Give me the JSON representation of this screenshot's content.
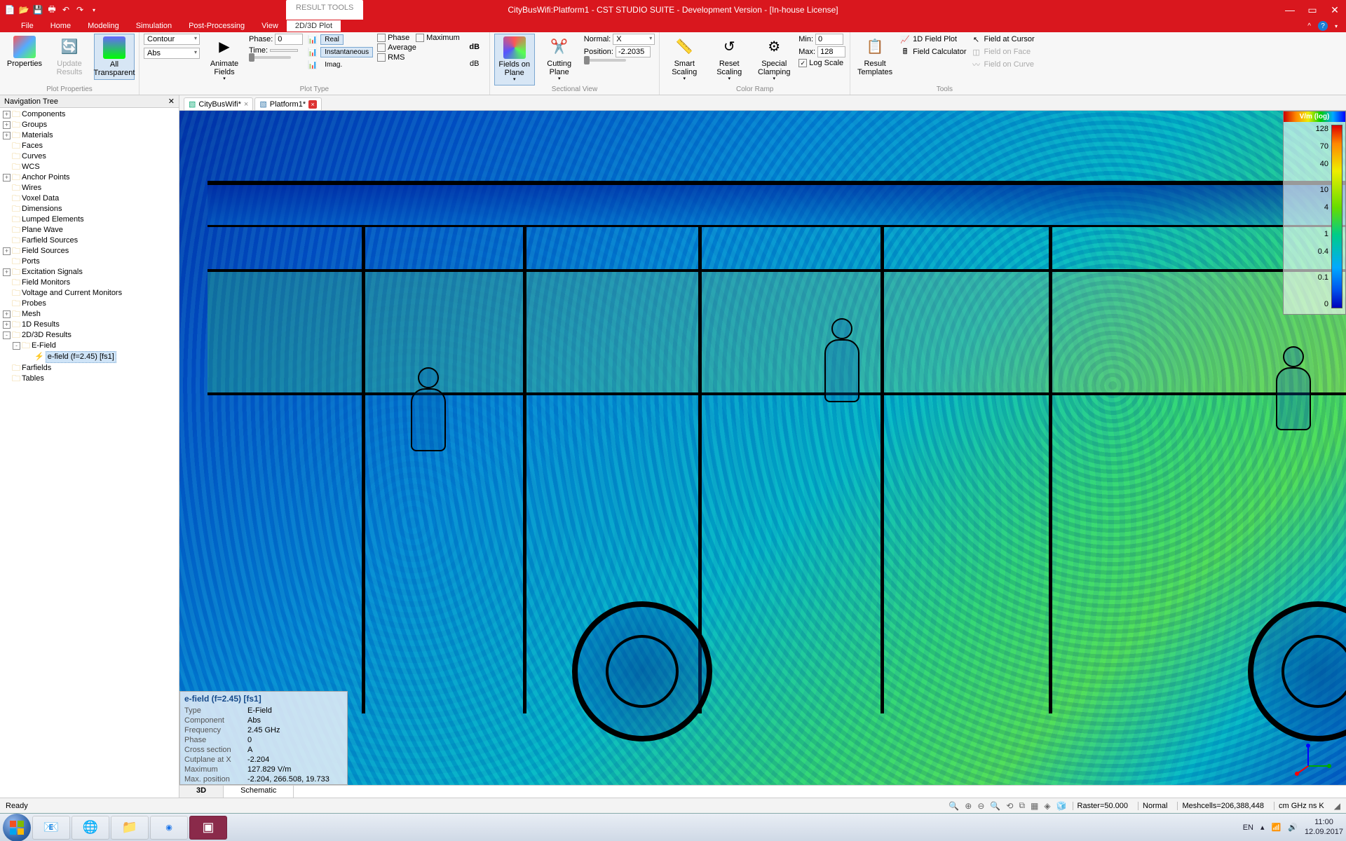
{
  "title": "CityBusWifi:Platform1 - CST STUDIO SUITE - Development Version - [In-house License]",
  "result_tools_label": "RESULT TOOLS",
  "menu": [
    "File",
    "Home",
    "Modeling",
    "Simulation",
    "Post-Processing",
    "View",
    "2D/3D Plot"
  ],
  "active_menu": "2D/3D Plot",
  "ribbon": {
    "groups": {
      "plot_properties": {
        "label": "Plot Properties",
        "properties_btn": "Properties",
        "update_results_btn": "Update\nResults",
        "all_transparent_btn": "All\nTransparent"
      },
      "plot_type": {
        "label": "Plot Type",
        "style_combo": "Contour",
        "component_combo": "Abs",
        "animate_fields_btn": "Animate\nFields",
        "phase_label": "Phase:",
        "phase_value": "0",
        "time_label": "Time:",
        "time_value": "",
        "real_btn": "Real",
        "instantaneous_btn": "Instantaneous",
        "imag_btn": "Imag.",
        "phase_chk": "Phase",
        "maximum_chk": "Maximum",
        "average_chk": "Average",
        "rms_chk": "RMS",
        "db_btn": "dB"
      },
      "sectional_view": {
        "label": "Sectional View",
        "fields_on_plane_btn": "Fields on\nPlane",
        "cutting_plane_btn": "Cutting\nPlane",
        "normal_label": "Normal:",
        "normal_value": "X",
        "position_label": "Position:",
        "position_value": "-2.2035"
      },
      "color_ramp": {
        "label": "Color Ramp",
        "smart_scaling_btn": "Smart\nScaling",
        "reset_scaling_btn": "Reset\nScaling",
        "special_clamping_btn": "Special\nClamping",
        "min_label": "Min:",
        "min_value": "0",
        "max_label": "Max:",
        "max_value": "128",
        "log_scale_chk": "Log Scale"
      },
      "tools": {
        "label": "Tools",
        "result_templates_btn": "Result\nTemplates",
        "fieldplot_1d": "1D Field Plot",
        "field_calculator": "Field Calculator",
        "field_at_cursor": "Field at Cursor",
        "field_on_face": "Field on Face",
        "field_on_curve": "Field on Curve"
      }
    }
  },
  "navtree": {
    "title": "Navigation Tree",
    "items": [
      {
        "l": 0,
        "e": "+",
        "t": "Components"
      },
      {
        "l": 0,
        "e": "+",
        "t": "Groups"
      },
      {
        "l": 0,
        "e": "+",
        "t": "Materials"
      },
      {
        "l": 0,
        "e": "",
        "t": "Faces"
      },
      {
        "l": 0,
        "e": "",
        "t": "Curves"
      },
      {
        "l": 0,
        "e": "",
        "t": "WCS"
      },
      {
        "l": 0,
        "e": "+",
        "t": "Anchor Points"
      },
      {
        "l": 0,
        "e": "",
        "t": "Wires"
      },
      {
        "l": 0,
        "e": "",
        "t": "Voxel Data"
      },
      {
        "l": 0,
        "e": "",
        "t": "Dimensions"
      },
      {
        "l": 0,
        "e": "",
        "t": "Lumped Elements"
      },
      {
        "l": 0,
        "e": "",
        "t": "Plane Wave"
      },
      {
        "l": 0,
        "e": "",
        "t": "Farfield Sources"
      },
      {
        "l": 0,
        "e": "+",
        "t": "Field Sources"
      },
      {
        "l": 0,
        "e": "",
        "t": "Ports"
      },
      {
        "l": 0,
        "e": "+",
        "t": "Excitation Signals"
      },
      {
        "l": 0,
        "e": "",
        "t": "Field Monitors"
      },
      {
        "l": 0,
        "e": "",
        "t": "Voltage and Current Monitors"
      },
      {
        "l": 0,
        "e": "",
        "t": "Probes"
      },
      {
        "l": 0,
        "e": "+",
        "t": "Mesh"
      },
      {
        "l": 0,
        "e": "+",
        "t": "1D Results"
      },
      {
        "l": 0,
        "e": "-",
        "t": "2D/3D Results"
      },
      {
        "l": 1,
        "e": "-",
        "t": "E-Field"
      },
      {
        "l": 2,
        "e": "",
        "t": "e-field (f=2.45) [fs1]",
        "sel": true,
        "icon": "⚡"
      },
      {
        "l": 0,
        "e": "",
        "t": "Farfields"
      },
      {
        "l": 0,
        "e": "",
        "t": "Tables"
      }
    ]
  },
  "doc_tabs": [
    {
      "label": "CityBusWifi*",
      "close": "plain"
    },
    {
      "label": "Platform1*",
      "close": "red"
    }
  ],
  "legend": {
    "title": "V/m (log)",
    "ticks": [
      "128",
      "70",
      "40",
      "",
      "10",
      "4",
      "",
      "1",
      "0.4",
      "",
      "0.1",
      "",
      "0"
    ]
  },
  "feature_info": {
    "title": "e-field (f=2.45) [fs1]",
    "rows": [
      [
        "Type",
        "E-Field"
      ],
      [
        "Component",
        "Abs"
      ],
      [
        "Frequency",
        "2.45 GHz"
      ],
      [
        "Phase",
        "0"
      ],
      [
        "Cross section",
        "A"
      ],
      [
        "Cutplane at X",
        "-2.204"
      ],
      [
        "Maximum",
        "127.829 V/m"
      ],
      [
        "Max. position",
        "-2.204,  266.508,   19.733"
      ]
    ]
  },
  "view_tabs": [
    "3D",
    "Schematic"
  ],
  "active_view_tab": "3D",
  "statusbar": {
    "ready": "Ready",
    "raster": "Raster=50.000",
    "normal": "Normal",
    "meshcells": "Meshcells=206,388,448",
    "units": "cm  GHz  ns  K"
  },
  "taskbar": {
    "lang": "EN",
    "time": "11:00",
    "date": "12.09.2017"
  }
}
